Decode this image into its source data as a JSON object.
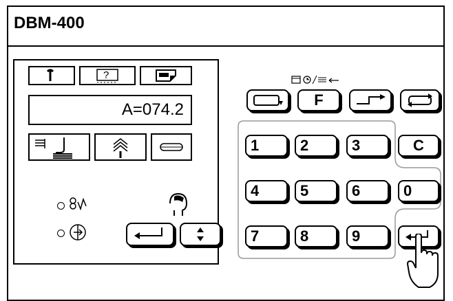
{
  "device": {
    "title": "DBM-400"
  },
  "display": {
    "value": "A=074.2"
  },
  "top_icons": [
    "wrench-icon",
    "help-icon",
    "print-icon"
  ],
  "mode_icons": [
    "feed-stack-icon",
    "tree-icon",
    "link-icon"
  ],
  "status": {
    "leds": [
      "recipe-led",
      "power-led"
    ]
  },
  "func_label": "",
  "keys": {
    "f": "F",
    "n1": "1",
    "n2": "2",
    "n3": "3",
    "n4": "4",
    "n5": "5",
    "n6": "6",
    "n7": "7",
    "n8": "8",
    "n9": "9",
    "n0": "0",
    "c": "C"
  }
}
